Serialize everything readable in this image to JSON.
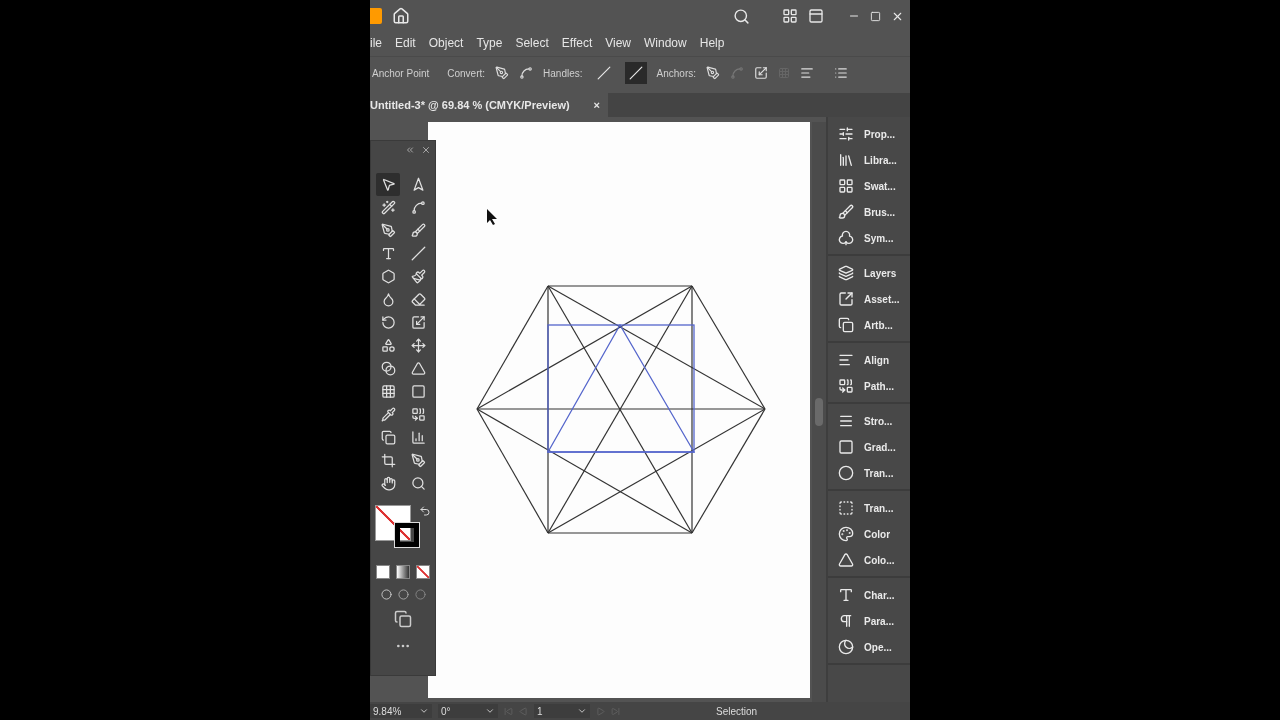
{
  "menu": [
    "ile",
    "Edit",
    "Object",
    "Type",
    "Select",
    "Effect",
    "View",
    "Window",
    "Help"
  ],
  "control_bar": {
    "title": "Anchor Point",
    "convert_label": "Convert:",
    "handles_label": "Handles:",
    "handles": [
      {
        "selected": false
      },
      {
        "selected": true
      }
    ],
    "anchors_label": "Anchors:"
  },
  "document_tab": {
    "title": "Untitled-3* @ 69.84 % (CMYK/Preview)",
    "close": "×"
  },
  "tools": [
    {
      "selected": true
    },
    {
      "selected": false
    },
    {
      "selected": false
    },
    {
      "selected": false
    },
    {
      "selected": false
    },
    {
      "selected": false
    },
    {
      "selected": false
    },
    {
      "selected": false
    },
    {
      "selected": false
    },
    {
      "selected": false
    },
    {
      "selected": false
    },
    {
      "selected": false
    },
    {
      "selected": false
    },
    {
      "selected": false
    },
    {
      "selected": false
    },
    {
      "selected": false
    },
    {
      "selected": false
    },
    {
      "selected": false
    },
    {
      "selected": false
    },
    {
      "selected": false
    },
    {
      "selected": false
    },
    {
      "selected": false
    },
    {
      "selected": false
    },
    {
      "selected": false
    },
    {
      "selected": false
    },
    {
      "selected": false
    },
    {
      "selected": false
    },
    {
      "selected": false
    }
  ],
  "panels": [
    [
      "Prop...",
      "Libra...",
      "Swat...",
      "Brus...",
      "Sym..."
    ],
    [
      "Layers",
      "Asset...",
      "Artb..."
    ],
    [
      "Align",
      "Path..."
    ],
    [
      "Stro...",
      "Grad...",
      "Tran..."
    ],
    [
      "Tran...",
      "Color",
      "Colo..."
    ],
    [
      "Char...",
      "Para...",
      "Ope..."
    ]
  ],
  "status_bar": {
    "zoom": "9.84%",
    "rotation": "0°",
    "artboard": "1",
    "tool": "Selection"
  }
}
